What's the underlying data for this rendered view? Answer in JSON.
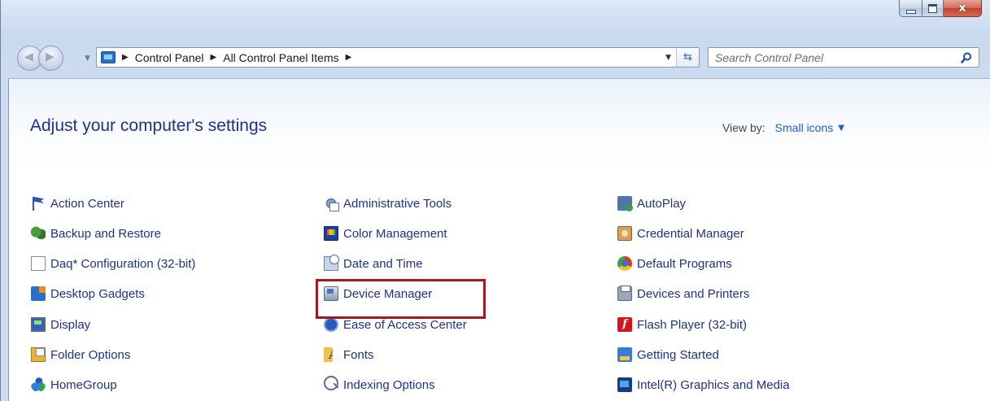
{
  "window": {
    "minimize_label": "minimize",
    "maximize_label": "maximize",
    "close_glyph": "x"
  },
  "nav": {
    "breadcrumb": [
      "Control Panel",
      "All Control Panel Items"
    ],
    "search_placeholder": "Search Control Panel"
  },
  "header": {
    "title": "Adjust your computer's settings",
    "view_by_label": "View by:",
    "view_by_value": "Small icons"
  },
  "items": {
    "col1": [
      "Action Center",
      "Backup and Restore",
      "Daq* Configuration (32-bit)",
      "Desktop Gadgets",
      "Display",
      "Folder Options",
      "HomeGroup"
    ],
    "col2": [
      "Administrative Tools",
      "Color Management",
      "Date and Time",
      "Device Manager",
      "Ease of Access Center",
      "Fonts",
      "Indexing Options"
    ],
    "col3": [
      "AutoPlay",
      "Credential Manager",
      "Default Programs",
      "Devices and Printers",
      "Flash Player (32-bit)",
      "Getting Started",
      "Intel(R) Graphics and Media"
    ]
  },
  "highlight": {
    "target": "Device Manager",
    "color": "#a31a1e"
  },
  "colors": {
    "link": "#1e3287",
    "accent": "#1a5fd6"
  }
}
